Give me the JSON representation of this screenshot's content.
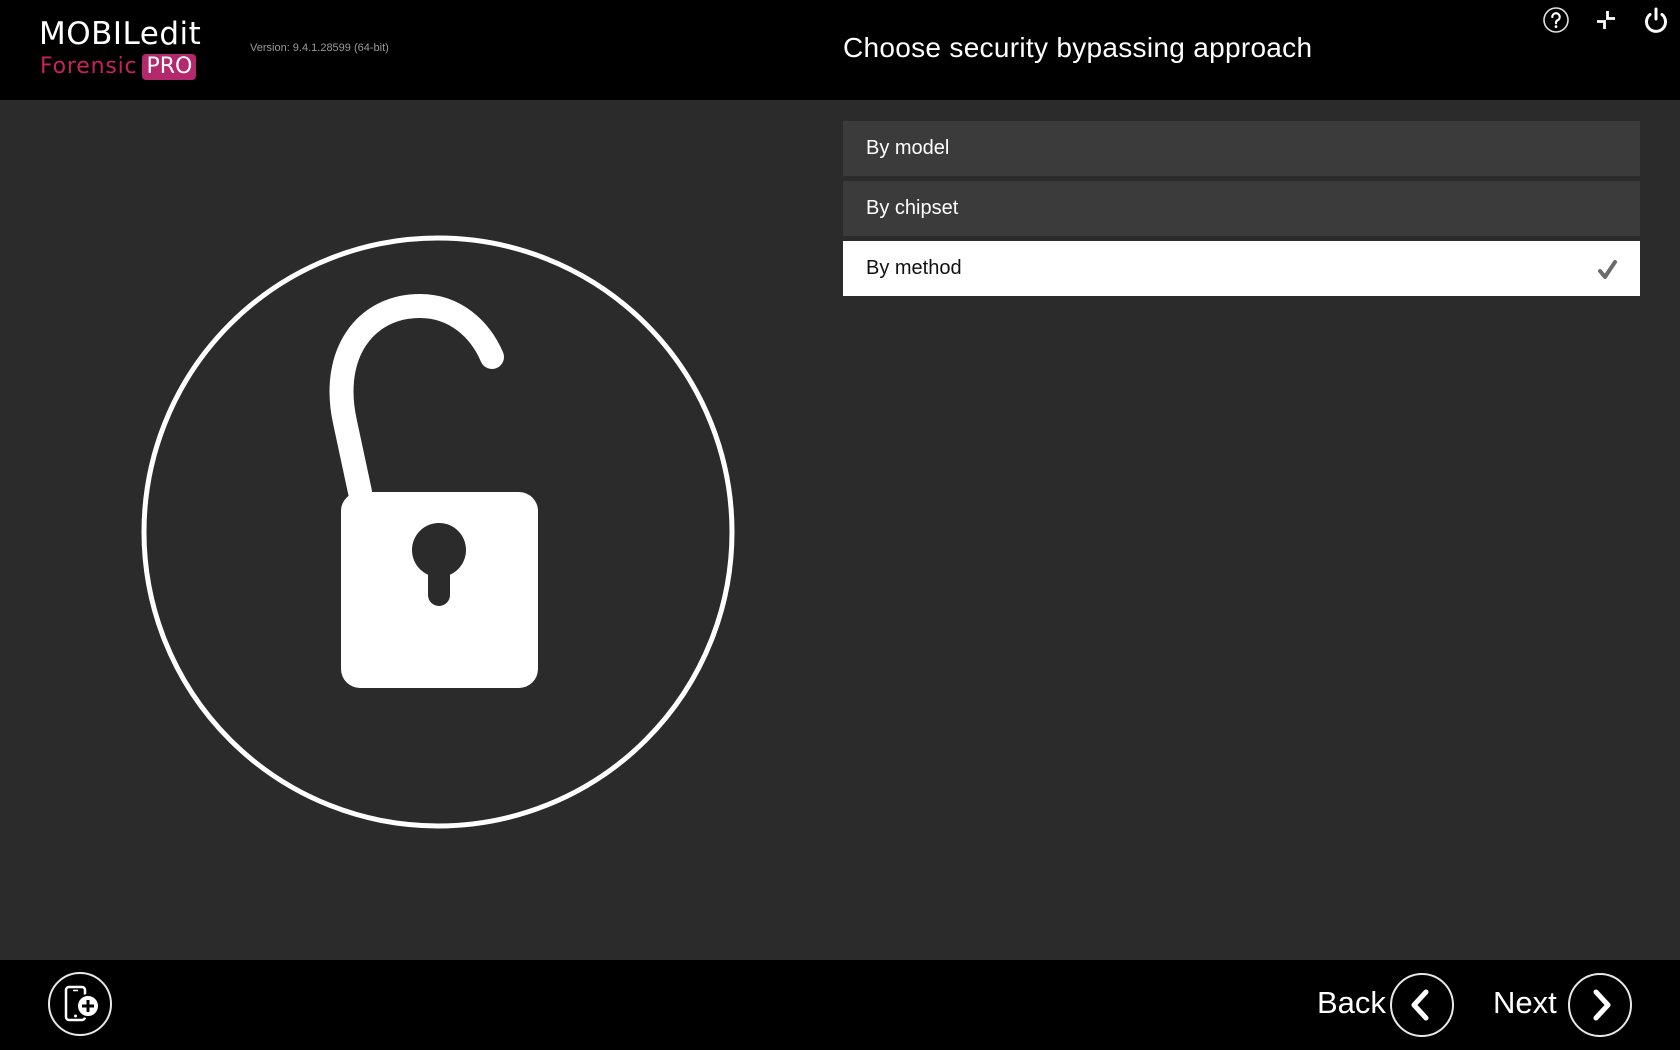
{
  "app": {
    "logo_main": "MOBILedit",
    "logo_forensic": "Forensic",
    "logo_pro": "PRO",
    "version": "Version: 9.4.1.28599 (64-bit)"
  },
  "header": {
    "title": "Choose security bypassing approach",
    "icons": [
      "help-icon",
      "compress-icon",
      "power-icon"
    ]
  },
  "illustration": {
    "icon": "unlocked-padlock-icon"
  },
  "options": [
    {
      "label": "By model",
      "selected": false
    },
    {
      "label": "By chipset",
      "selected": false
    },
    {
      "label": "By method",
      "selected": true
    }
  ],
  "footer": {
    "add_device_icon": "add-phone-icon",
    "back_label": "Back",
    "next_label": "Next"
  },
  "colors": {
    "brand_pink": "#c8225e",
    "pro_badge": "#b4286e",
    "background": "#2b2b2b",
    "option_bg": "#3b3b3b",
    "option_selected_bg": "#ffffff",
    "check": "#6b6b6b"
  }
}
